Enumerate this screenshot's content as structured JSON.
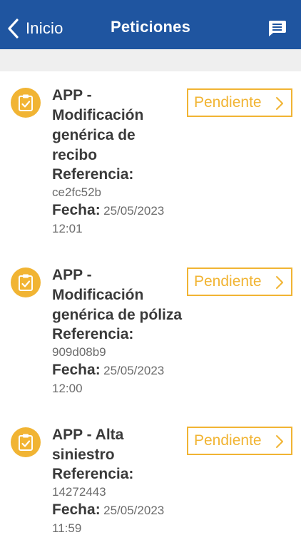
{
  "navbar": {
    "back_label": "Inicio",
    "title": "Peticiones",
    "colors": {
      "background": "#1f55a0",
      "text": "#ffffff"
    }
  },
  "icons": {
    "back": "chevron-left-icon",
    "chat": "chat-icon",
    "item": "clipboard-check-icon",
    "status_arrow": "chevron-right-icon"
  },
  "labels": {
    "reference": "Referencia:",
    "date": "Fecha:"
  },
  "requests": [
    {
      "title_lines": [
        "APP -",
        "Modificación",
        "genérica de",
        "recibo"
      ],
      "reference": "ce2fc52b",
      "date": "25/05/2023",
      "time": "12:01",
      "status": "Pendiente"
    },
    {
      "title_lines": [
        "APP -",
        "Modificación",
        "genérica de póliza"
      ],
      "reference": "909d08b9",
      "date": "25/05/2023",
      "time": "12:00",
      "status": "Pendiente"
    },
    {
      "title_lines": [
        "APP - Alta",
        "siniestro"
      ],
      "reference": "14272443",
      "date": "25/05/2023",
      "time": "11:59",
      "status": "Pendiente"
    }
  ],
  "accent_color": "#f1b433"
}
